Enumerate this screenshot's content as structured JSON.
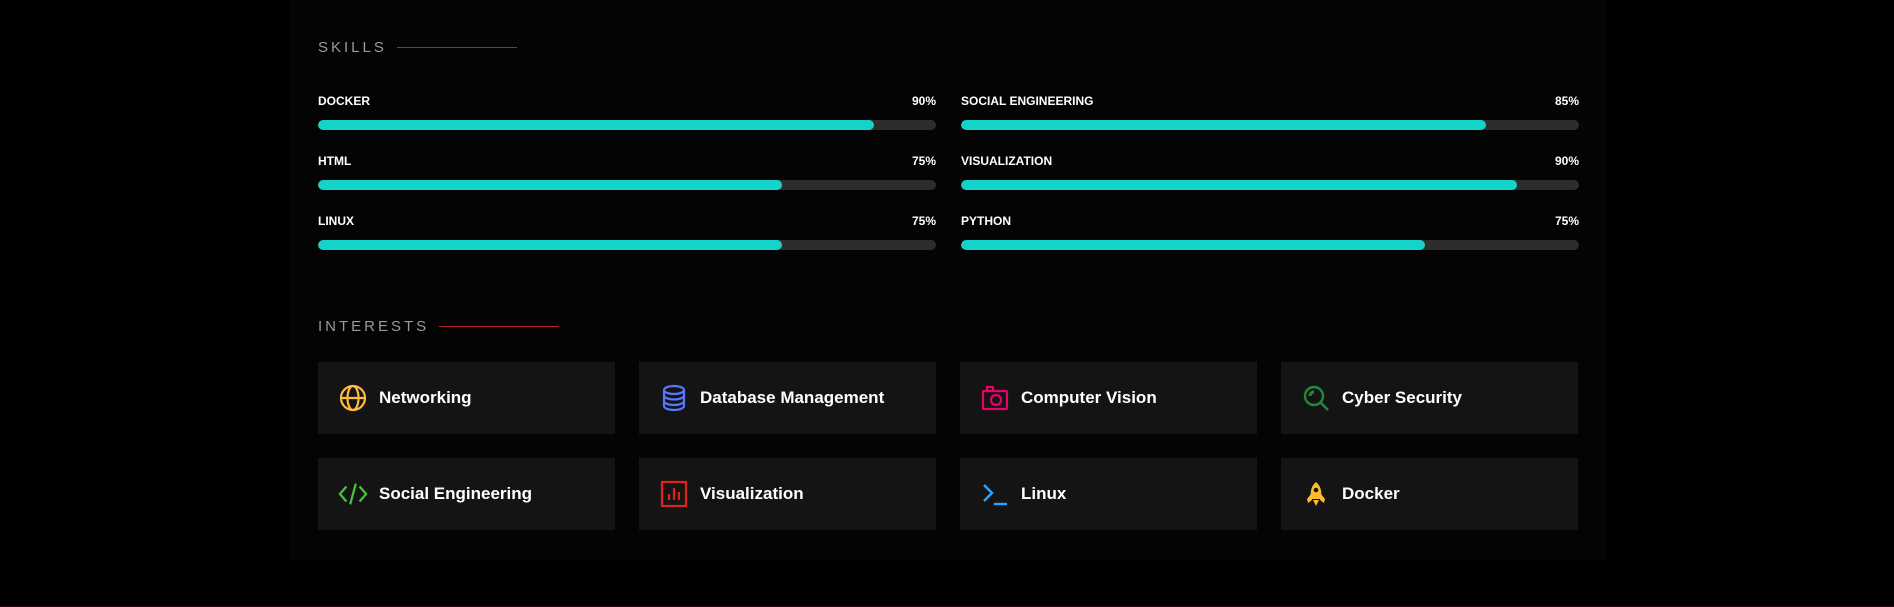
{
  "skills": {
    "title": "SKILLS",
    "accent_color": "#c0192a",
    "bar_color": "#14d3c8",
    "track_color": "#2d2d2d",
    "items": [
      {
        "name": "DOCKER",
        "percent_label": "90%",
        "value": 90
      },
      {
        "name": "SOCIAL ENGINEERING",
        "percent_label": "85%",
        "value": 85
      },
      {
        "name": "HTML",
        "percent_label": "75%",
        "value": 75
      },
      {
        "name": "VISUALIZATION",
        "percent_label": "90%",
        "value": 90
      },
      {
        "name": "LINUX",
        "percent_label": "75%",
        "value": 75
      },
      {
        "name": "PYTHON",
        "percent_label": "75%",
        "value": 75
      }
    ]
  },
  "interests": {
    "title": "INTERESTS",
    "items": [
      {
        "label": "Networking",
        "icon": "globe-icon",
        "color": "#ffbd39"
      },
      {
        "label": "Database Management",
        "icon": "database-icon",
        "color": "#5578ff"
      },
      {
        "label": "Computer Vision",
        "icon": "camera-icon",
        "color": "#e80368"
      },
      {
        "label": "Cyber Security",
        "icon": "search-icon",
        "color": "#11dbcf"
      },
      {
        "label": "Social Engineering",
        "icon": "code-icon",
        "color": "#47c141"
      },
      {
        "label": "Visualization",
        "icon": "chart-icon",
        "color": "#e2211c"
      },
      {
        "label": "Linux",
        "icon": "terminal-icon",
        "color": "#29cc61"
      },
      {
        "label": "Docker",
        "icon": "rocket-icon",
        "color": "#ffbb2c"
      }
    ]
  }
}
